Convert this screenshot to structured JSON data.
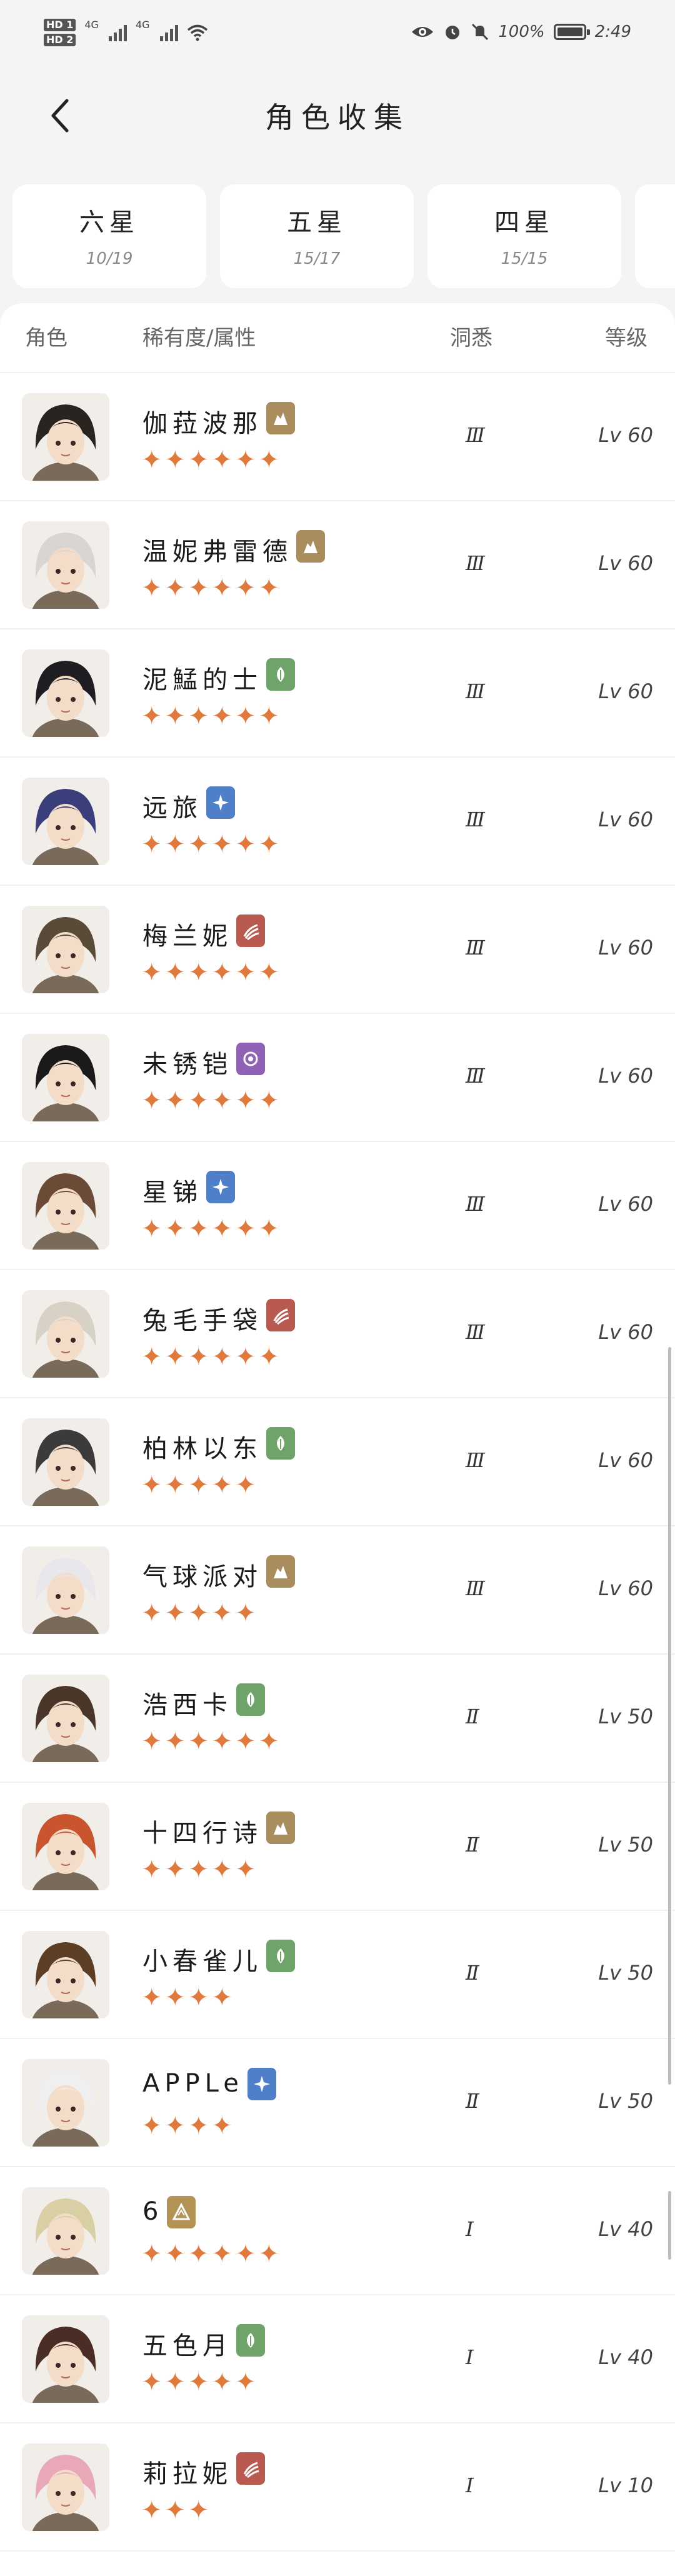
{
  "status": {
    "hd1": "HD 1",
    "hd2": "HD 2",
    "net1": "4G",
    "net2": "4G",
    "battery_text": "100%",
    "battery_level": 1.0,
    "time": "2:49",
    "icons": [
      "eye-icon",
      "alarm-icon",
      "mute-icon",
      "battery-icon"
    ]
  },
  "header": {
    "title": "角色收集"
  },
  "tabs": [
    {
      "label": "六星",
      "count": "10/19"
    },
    {
      "label": "五星",
      "count": "15/17"
    },
    {
      "label": "四星",
      "count": "15/15"
    },
    {
      "label": "",
      "count": ""
    }
  ],
  "columns": {
    "role": "角色",
    "rarity_attr": "稀有度/属性",
    "insight": "洞悉",
    "level": "等级"
  },
  "attributes": {
    "rock": {
      "color": "#a98d5f",
      "icon": "rock-icon"
    },
    "plant": {
      "color": "#6ea46a",
      "icon": "leaf-icon"
    },
    "star": {
      "color": "#4f7fc9",
      "icon": "star-icon"
    },
    "beast": {
      "color": "#b85a4f",
      "icon": "claw-icon"
    },
    "spirit": {
      "color": "#8f62b5",
      "icon": "moon-icon"
    },
    "mineral": {
      "color": "#b39256",
      "icon": "crystal-icon"
    }
  },
  "characters": [
    {
      "name": "伽菈波那",
      "attr": "rock",
      "stars": 6,
      "insight": "Ⅲ",
      "level": "Lv 60"
    },
    {
      "name": "温妮弗雷德",
      "attr": "rock",
      "stars": 6,
      "insight": "Ⅲ",
      "level": "Lv 60"
    },
    {
      "name": "泥鯭的士",
      "attr": "plant",
      "stars": 6,
      "insight": "Ⅲ",
      "level": "Lv 60"
    },
    {
      "name": "远旅",
      "attr": "star",
      "stars": 6,
      "insight": "Ⅲ",
      "level": "Lv 60"
    },
    {
      "name": "梅兰妮",
      "attr": "beast",
      "stars": 6,
      "insight": "Ⅲ",
      "level": "Lv 60"
    },
    {
      "name": "未锈铠",
      "attr": "spirit",
      "stars": 6,
      "insight": "Ⅲ",
      "level": "Lv 60"
    },
    {
      "name": "星锑",
      "attr": "star",
      "stars": 6,
      "insight": "Ⅲ",
      "level": "Lv 60"
    },
    {
      "name": "兔毛手袋",
      "attr": "beast",
      "stars": 6,
      "insight": "Ⅲ",
      "level": "Lv 60"
    },
    {
      "name": "柏林以东",
      "attr": "plant",
      "stars": 5,
      "insight": "Ⅲ",
      "level": "Lv 60"
    },
    {
      "name": "气球派对",
      "attr": "rock",
      "stars": 5,
      "insight": "Ⅲ",
      "level": "Lv 60"
    },
    {
      "name": "浩西卡",
      "attr": "plant",
      "stars": 6,
      "insight": "Ⅱ",
      "level": "Lv 50"
    },
    {
      "name": "十四行诗",
      "attr": "rock",
      "stars": 5,
      "insight": "Ⅱ",
      "level": "Lv 50"
    },
    {
      "name": "小春雀儿",
      "attr": "plant",
      "stars": 4,
      "insight": "Ⅱ",
      "level": "Lv 50"
    },
    {
      "name": "APPLe",
      "attr": "star",
      "stars": 4,
      "insight": "Ⅱ",
      "level": "Lv 50"
    },
    {
      "name": "6",
      "attr": "mineral",
      "stars": 6,
      "insight": "Ⅰ",
      "level": "Lv 40"
    },
    {
      "name": "五色月",
      "attr": "plant",
      "stars": 5,
      "insight": "Ⅰ",
      "level": "Lv 40"
    },
    {
      "name": "莉拉妮",
      "attr": "beast",
      "stars": 3,
      "insight": "Ⅰ",
      "level": "Lv 10"
    }
  ]
}
